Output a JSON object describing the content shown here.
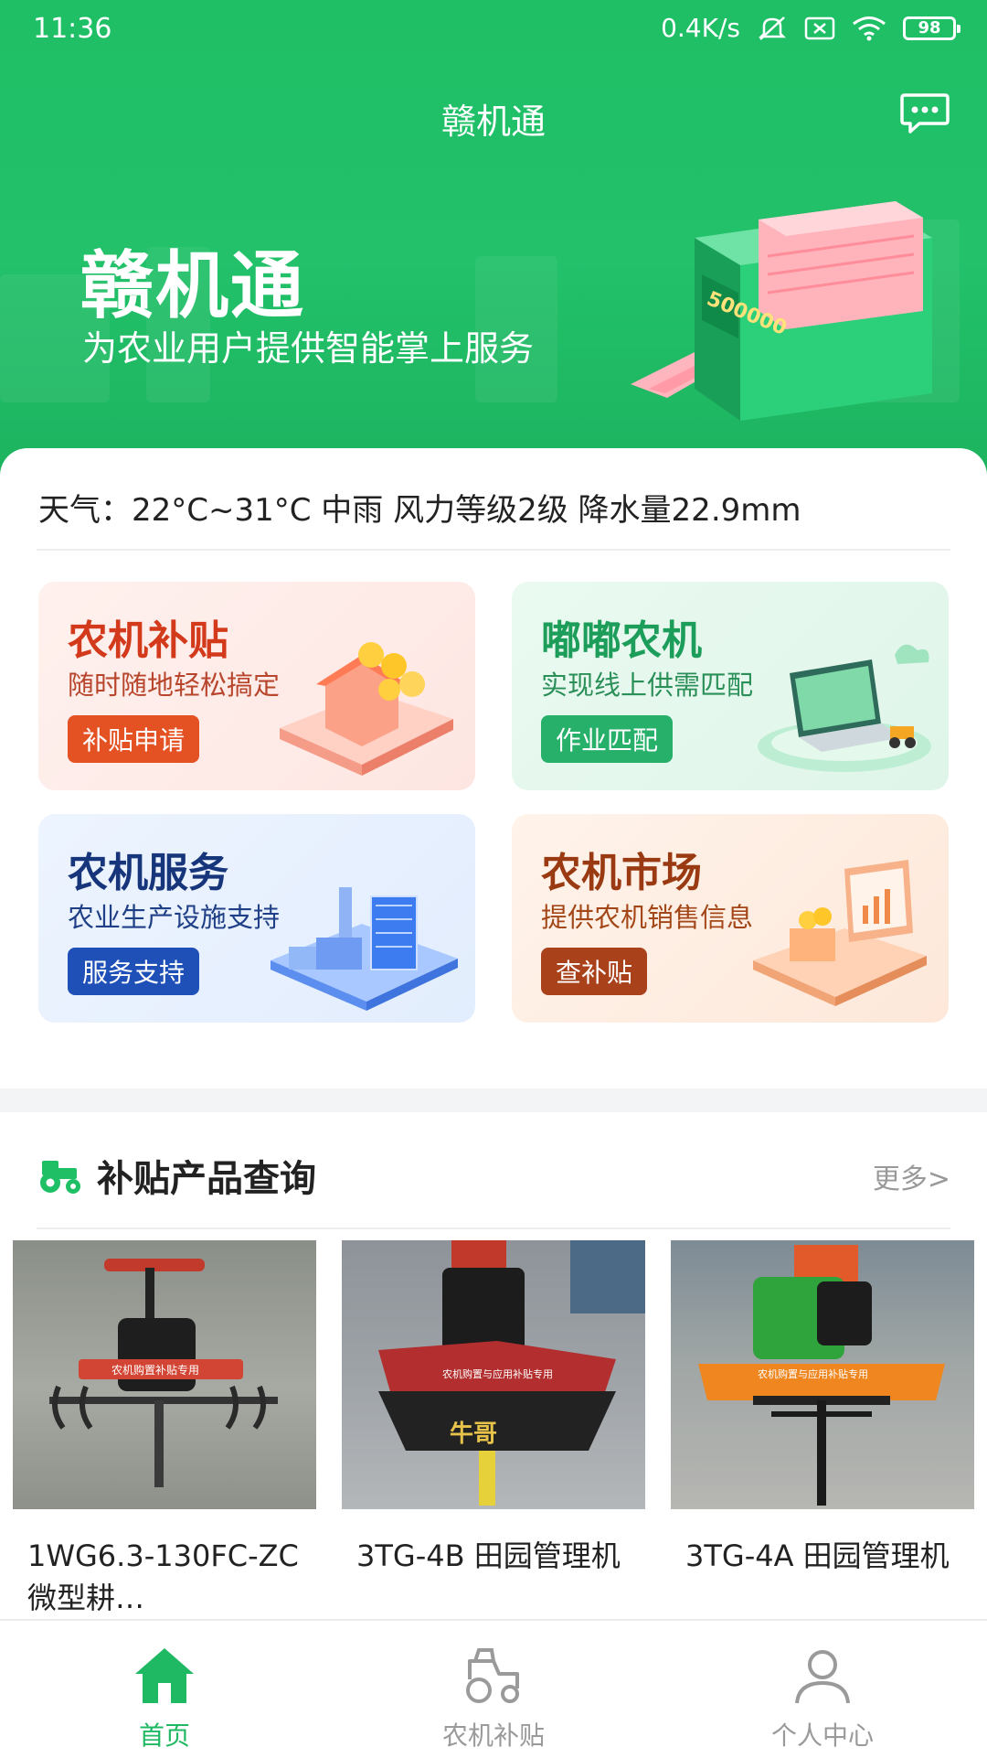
{
  "status_bar": {
    "time": "11:36",
    "net_speed": "0.4K/s",
    "battery": "98",
    "icons": [
      "mute-bell-icon",
      "sim-x-icon",
      "wifi-icon",
      "battery-icon"
    ]
  },
  "app_bar": {
    "title": "赣机通",
    "message_icon": "chat-bubble-icon"
  },
  "banner": {
    "title": "赣机通",
    "subtitle": "为农业用户提供智能掌上服务",
    "art_text": "500000"
  },
  "weather": {
    "text": "天气：22°C~31°C 中雨 风力等级2级 降水量22.9mm"
  },
  "tiles": [
    {
      "title": "农机补贴",
      "subtitle": "随时随地轻松搞定",
      "button": "补贴申请",
      "color": "#e45123"
    },
    {
      "title": "嘟嘟农机",
      "subtitle": "实现线上供需匹配",
      "button": "作业匹配",
      "color": "#27b06a"
    },
    {
      "title": "农机服务",
      "subtitle": "农业生产设施支持",
      "button": "服务支持",
      "color": "#1e50b8"
    },
    {
      "title": "农机市场",
      "subtitle": "提供农机销售信息",
      "button": "查补贴",
      "color": "#a9411a"
    }
  ],
  "products_section": {
    "title": "补贴产品查询",
    "more": "更多>",
    "icon": "tractor-icon",
    "items": [
      {
        "name": "1WG6.3-130FC-ZC 微型耕…",
        "image_label": "农机购置补贴专用"
      },
      {
        "name": "3TG-4B 田园管理机",
        "image_label": "农机购置与应用补贴专用",
        "brand": "牛哥"
      },
      {
        "name": "3TG-4A 田园管理机",
        "image_label": "农机购置与应用补贴专用"
      }
    ]
  },
  "tab_bar": {
    "tabs": [
      {
        "label": "首页",
        "icon": "home-icon",
        "active": true
      },
      {
        "label": "农机补贴",
        "icon": "tractor-outline-icon",
        "active": false
      },
      {
        "label": "个人中心",
        "icon": "user-icon",
        "active": false
      }
    ],
    "active_color": "#1fb863"
  }
}
